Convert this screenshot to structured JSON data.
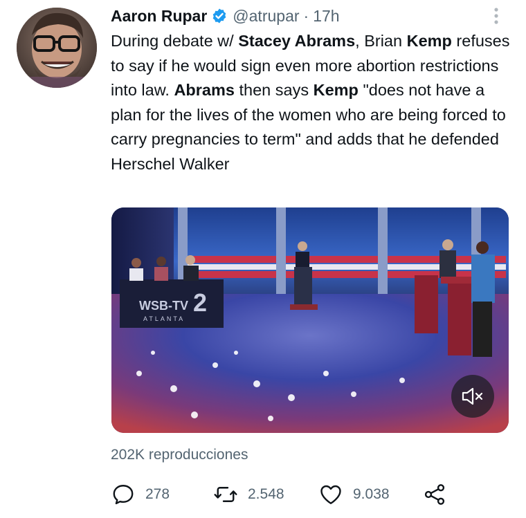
{
  "author": {
    "name": "Aaron Rupar",
    "handle": "@atrupar",
    "separator": "·",
    "time": "17h"
  },
  "tweet": {
    "segments": [
      {
        "text": "During debate w/ ",
        "bold": false
      },
      {
        "text": "Stacey Abrams",
        "bold": true
      },
      {
        "text": ", Brian ",
        "bold": false
      },
      {
        "text": "Kemp",
        "bold": true
      },
      {
        "text": " refuses to say if he would sign even more abortion restrictions into law. ",
        "bold": false
      },
      {
        "text": "Abrams",
        "bold": true
      },
      {
        "text": " then says ",
        "bold": false
      },
      {
        "text": "Kemp",
        "bold": true
      },
      {
        "text": " \"does not have a plan for the lives of the women who are being forced to carry pregnancies to term\" and adds that he defended Herschel Walker",
        "bold": false
      }
    ]
  },
  "media": {
    "station_logo": "WSB-TV",
    "station_city": "ATLANTA",
    "station_number": "2",
    "mute_icon": "volume-muted-icon"
  },
  "stats": {
    "views_label": "202K reproducciones"
  },
  "actions": {
    "reply_count": "278",
    "retweet_count": "2.548",
    "like_count": "9.038"
  },
  "colors": {
    "text_primary": "#0f1419",
    "text_secondary": "#536471",
    "verified_blue": "#1d9bf0"
  }
}
